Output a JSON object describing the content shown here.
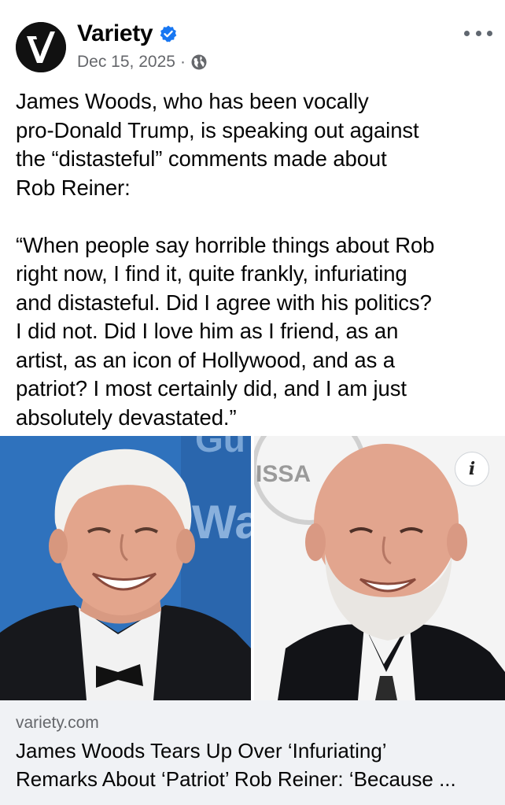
{
  "post": {
    "author": "Variety",
    "date": "Dec 15, 2025",
    "separator": "·",
    "audience_icon": "globe-icon",
    "verified_icon": "verified-badge-icon",
    "more_icon": "more-options-icon",
    "text_intro": "James Woods, who has been vocally\npro-Donald Trump, is speaking out against\nthe “distasteful” comments made about\nRob Reiner:",
    "text_quote": "“When people say horrible things about Rob\nright now, I find it, quite frankly, infuriating\nand distasteful. Did I agree with his politics?\nI did not. Did I love him as I friend, as an\nartist, as an icon of Hollywood, and as a\npatriot? I most certainly did, and I am just\nabsolutely devastated.”"
  },
  "media": {
    "left_photo": "photo of James Woods",
    "right_photo": "photo of Rob Reiner",
    "left_backdrop_text": "Wa",
    "right_backdrop_text": "ISSA",
    "info_label": "i"
  },
  "link": {
    "domain": "variety.com",
    "title": "James Woods Tears Up Over ‘Infuriating’\nRemarks About ‘Patriot’ Rob Reiner: ‘Because ..."
  },
  "colors": {
    "verified_blue": "#1877f2",
    "secondary_text": "#65676b",
    "link_card_bg": "#f0f2f5"
  }
}
